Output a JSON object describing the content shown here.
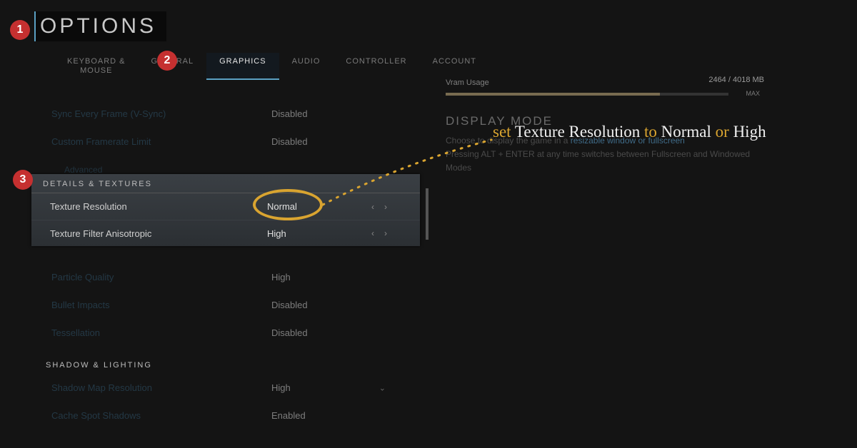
{
  "title": "OPTIONS",
  "tabs": {
    "km_line1": "KEYBOARD &",
    "km_line2": "MOUSE",
    "general": "GENERAL",
    "graphics": "GRAPHICS",
    "audio": "AUDIO",
    "controller": "CONTROLLER",
    "account": "ACCOUNT"
  },
  "rows": {
    "vsync_label": "Sync Every Frame (V-Sync)",
    "vsync_value": "Disabled",
    "fps_label": "Custom Framerate Limit",
    "fps_value": "Disabled",
    "adv_label": "Advanced"
  },
  "details": {
    "header": "DETAILS & TEXTURES",
    "texres_label": "Texture Resolution",
    "texres_value": "Normal",
    "texfilter_label": "Texture Filter Anisotropic",
    "texfilter_value": "High"
  },
  "more": {
    "particle_label": "Particle Quality",
    "particle_value": "High",
    "bullet_label": "Bullet Impacts",
    "bullet_value": "Disabled",
    "tess_label": "Tessellation",
    "tess_value": "Disabled"
  },
  "shadow": {
    "header": "SHADOW & LIGHTING",
    "map_label": "Shadow Map Resolution",
    "map_value": "High",
    "spot_label": "Cache Spot Shadows",
    "spot_value": "Enabled"
  },
  "vram": {
    "label": "Vram Usage",
    "value": "2464 / 4018 MB",
    "max": "MAX"
  },
  "display": {
    "title": "DISPLAY MODE",
    "desc1": "Choose to display the game in a ",
    "link": "resizable window or fullscreen",
    "desc2a": "Pressing ",
    "desc2b": "ALT + ENTER at any time switches between Fullscreen and Windowed",
    "desc3": "Modes"
  },
  "annot": {
    "w_set": "set ",
    "w_tex": "Texture Resolution ",
    "w_to": "to ",
    "w_norm": "Normal ",
    "w_or": "or ",
    "w_high": "High"
  },
  "markers": {
    "m1": "1",
    "m2": "2",
    "m3": "3"
  }
}
